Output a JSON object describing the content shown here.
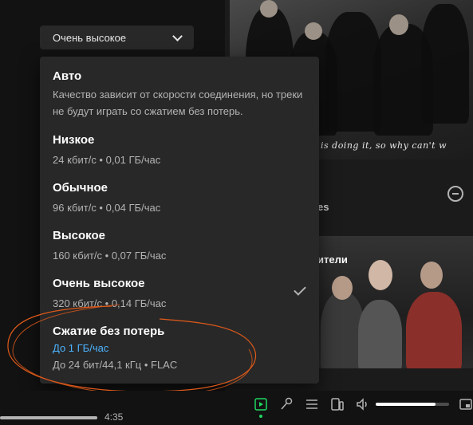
{
  "quality_select": {
    "value": "Очень высокое"
  },
  "dropdown": {
    "options": [
      {
        "title": "Авто",
        "desc": "Качество зависит от скорости соединения, но треки не будут играть со сжатием без потерь."
      },
      {
        "title": "Низкое",
        "desc": "24 кбит/с • 0,01 ГБ/час"
      },
      {
        "title": "Обычное",
        "desc": "96 кбит/с • 0,04 ГБ/час"
      },
      {
        "title": "Высокое",
        "desc": "160 кбит/с • 0,07 ГБ/час"
      },
      {
        "title": "Очень высокое",
        "desc": "320 кбит/с • 0,14 ГБ/час",
        "selected": true
      },
      {
        "title": "Сжатие без потерь",
        "link": "До 1 ГБ/час",
        "desc": "До 24 бит/44,1 кГц • FLAC"
      }
    ]
  },
  "right": {
    "handwriting": "... is doing it, so why can't w",
    "card_sub": "es",
    "caption": "ители"
  },
  "player": {
    "time": "4:35",
    "progress": 1.0,
    "volume": 0.82
  },
  "colors": {
    "accent_link": "#4cb3ff",
    "active_green": "#1ed760",
    "annotation": "#e05a1a"
  }
}
